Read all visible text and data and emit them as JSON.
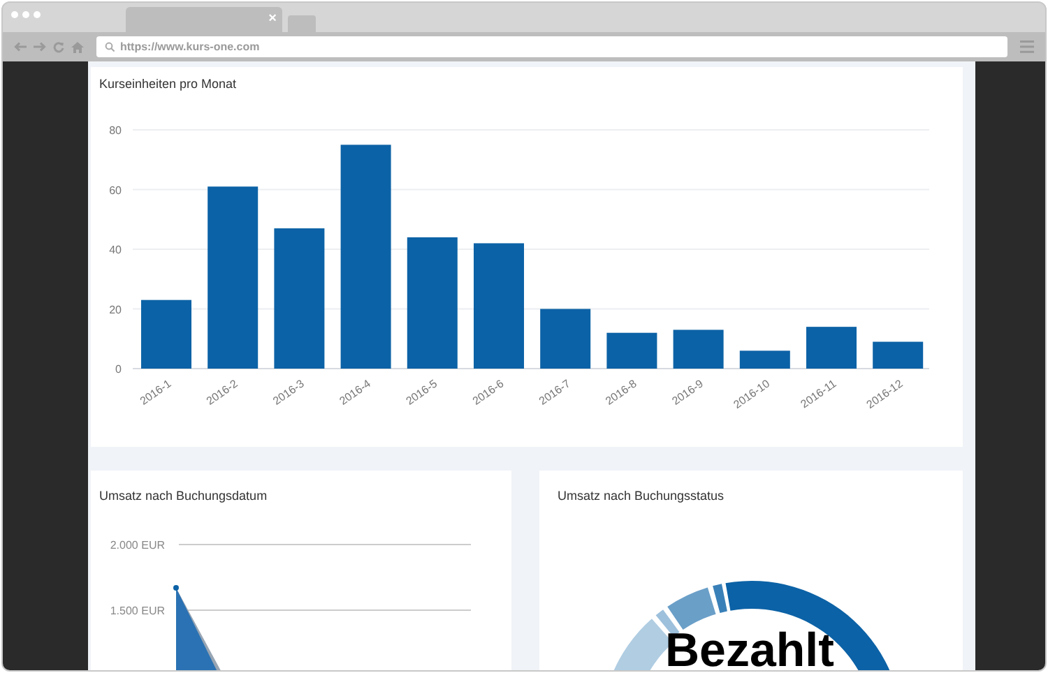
{
  "browser": {
    "url": "https://www.kurs-one.com",
    "tab_close": "×"
  },
  "units_chart": {
    "title": "Kurseinheiten pro Monat",
    "chart_data": {
      "type": "bar",
      "categories": [
        "2016-1",
        "2016-2",
        "2016-3",
        "2016-4",
        "2016-5",
        "2016-6",
        "2016-7",
        "2016-8",
        "2016-9",
        "2016-10",
        "2016-11",
        "2016-12"
      ],
      "series": [
        {
          "color": "#0c62a6",
          "values": [
            23,
            61,
            47,
            75,
            44,
            42,
            20,
            12,
            13,
            6,
            14,
            9
          ]
        }
      ],
      "ylim": [
        0,
        80
      ],
      "yticks": [
        0,
        20,
        40,
        60,
        80
      ],
      "grid": true
    }
  },
  "revenue_by_date": {
    "title": "Umsatz nach Buchungsdatum",
    "y_axis_labels": [
      "2.000 EUR",
      "1.500 EUR"
    ]
  },
  "revenue_by_status": {
    "title": "Umsatz nach Buchungsstatus",
    "center_label": "Bezahlt"
  }
}
